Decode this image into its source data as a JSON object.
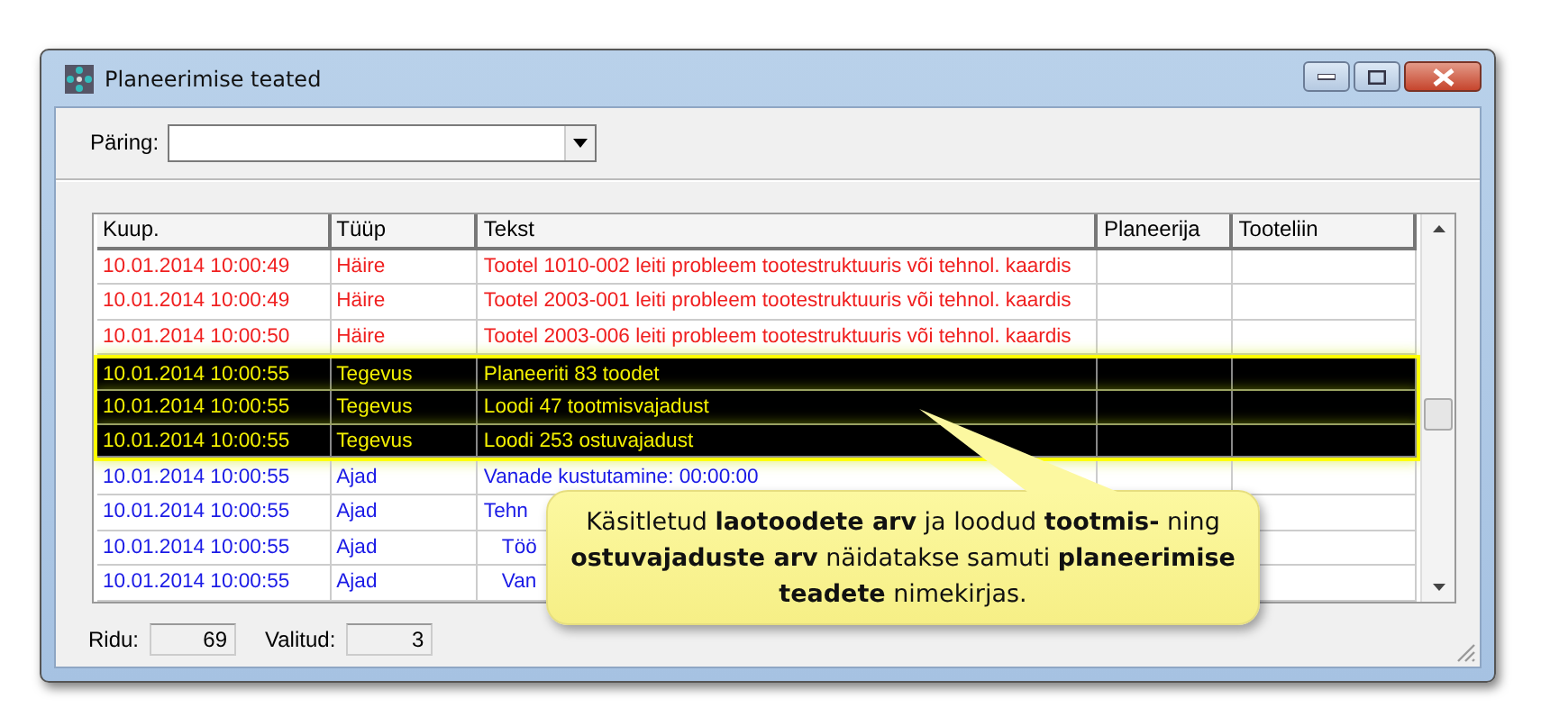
{
  "window": {
    "title": "Planeerimise teated"
  },
  "query": {
    "label": "Päring:"
  },
  "table": {
    "columns": [
      "Kuup.",
      "Tüüp",
      "Tekst",
      "Planeerija",
      "Tooteliin"
    ],
    "rows": [
      {
        "kind": "error",
        "selected": false,
        "cells": [
          "10.01.2014 10:00:49",
          "Häire",
          "Tootel 1010-002 leiti probleem tootestruktuuris või tehnol. kaardis",
          "",
          ""
        ]
      },
      {
        "kind": "error",
        "selected": false,
        "cells": [
          "10.01.2014 10:00:49",
          "Häire",
          "Tootel 2003-001 leiti probleem tootestruktuuris või tehnol. kaardis",
          "",
          ""
        ]
      },
      {
        "kind": "error",
        "selected": false,
        "cells": [
          "10.01.2014 10:00:50",
          "Häire",
          "Tootel 2003-006 leiti probleem tootestruktuuris või tehnol. kaardis",
          "",
          ""
        ]
      },
      {
        "kind": "action",
        "selected": true,
        "cells": [
          "10.01.2014 10:00:55",
          "Tegevus",
          "Planeeriti 83 toodet",
          "",
          ""
        ]
      },
      {
        "kind": "action",
        "selected": true,
        "cells": [
          "10.01.2014 10:00:55",
          "Tegevus",
          "Loodi 47 tootmisvajadust",
          "",
          ""
        ]
      },
      {
        "kind": "action",
        "selected": true,
        "cells": [
          "10.01.2014 10:00:55",
          "Tegevus",
          "Loodi 253 ostuvajadust",
          "",
          ""
        ]
      },
      {
        "kind": "time",
        "selected": false,
        "cells": [
          "10.01.2014 10:00:55",
          "Ajad",
          "Vanade kustutamine: 00:00:00",
          "",
          ""
        ]
      },
      {
        "kind": "time",
        "selected": false,
        "cells": [
          "10.01.2014 10:00:55",
          "Ajad",
          "Tehn",
          "",
          ""
        ]
      },
      {
        "kind": "time",
        "selected": false,
        "indent": true,
        "cells": [
          "10.01.2014 10:00:55",
          "Ajad",
          "Töö",
          "",
          ""
        ]
      },
      {
        "kind": "time",
        "selected": false,
        "indent": true,
        "cells": [
          "10.01.2014 10:00:55",
          "Ajad",
          "Van",
          "",
          ""
        ]
      }
    ]
  },
  "callout": {
    "text": "Käsitletud **laotoodete arv** ja loodud **tootmis-** ning **ostuvajaduste arv** näidatakse samuti **planeerimise teadete** nimekirjas."
  },
  "status_bar": [
    {
      "label": "Ridu:",
      "value": "69"
    },
    {
      "label": "Valitud:",
      "value": "3"
    }
  ]
}
